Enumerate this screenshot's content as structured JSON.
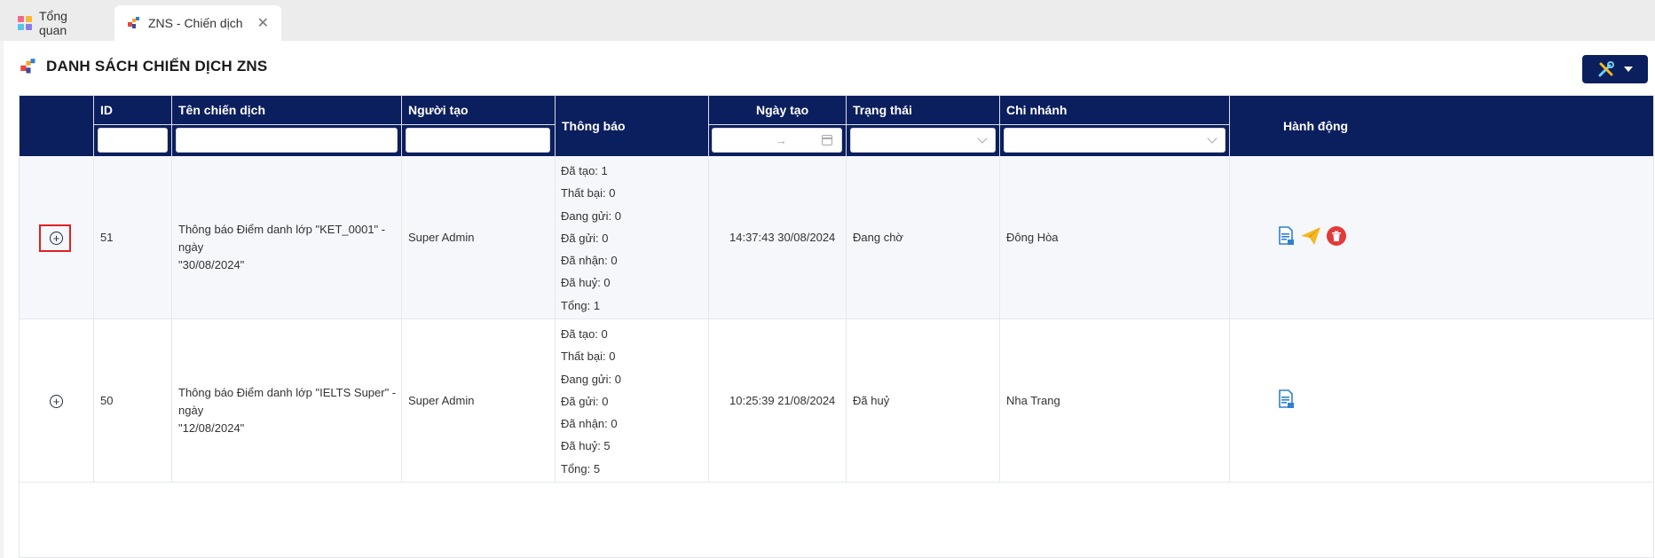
{
  "tabs": [
    {
      "label": "Tổng quan",
      "icon": "dashboard-grid-icon"
    },
    {
      "label": "ZNS - Chiến dịch",
      "icon": "zns-logo-icon",
      "active": true
    }
  ],
  "page": {
    "title": "DANH SÁCH CHIẾN DỊCH ZNS",
    "tools_icon": "tools-icon"
  },
  "table": {
    "columns": [
      "ID",
      "Tên chiến dịch",
      "Người tạo",
      "Thông báo",
      "Ngày tạo",
      "Trạng thái",
      "Chi nhánh",
      "Hành động"
    ],
    "date_range_separator": "→",
    "rows": [
      {
        "id": "51",
        "name_line1": "Thông báo Điểm danh lớp \"KET_0001\" - ngày",
        "name_line2": "\"30/08/2024\"",
        "creator": "Super Admin",
        "notifications": [
          "Đã tạo: 1",
          "Thất bại: 0",
          "Đang gửi: 0",
          "Đã gửi: 0",
          "Đã nhận: 0",
          "Đã huỷ: 0",
          "Tổng: 1"
        ],
        "created_at": "14:37:43 30/08/2024",
        "status": "Đang chờ",
        "branch": "Đông Hòa",
        "actions": [
          "export-doc-icon",
          "send-paper-plane-icon",
          "delete-trash-icon"
        ]
      },
      {
        "id": "50",
        "name_line1": "Thông báo Điểm danh lớp \"IELTS Super\" - ngày",
        "name_line2": "\"12/08/2024\"",
        "creator": "Super Admin",
        "notifications": [
          "Đã tạo: 0",
          "Thất bại: 0",
          "Đang gửi: 0",
          "Đã gửi: 0",
          "Đã nhận: 0",
          "Đã huỷ: 5",
          "Tổng: 5"
        ],
        "created_at": "10:25:39 21/08/2024",
        "status": "Đã huỷ",
        "branch": "Nha Trang",
        "actions": [
          "export-doc-icon"
        ]
      }
    ]
  },
  "colors": {
    "header_bg": "#0b1f5e",
    "highlight_border": "#e02020",
    "delete_red": "#e33b3b",
    "send_yellow": "#f5b820",
    "doc_blue": "#2f7fd3"
  }
}
